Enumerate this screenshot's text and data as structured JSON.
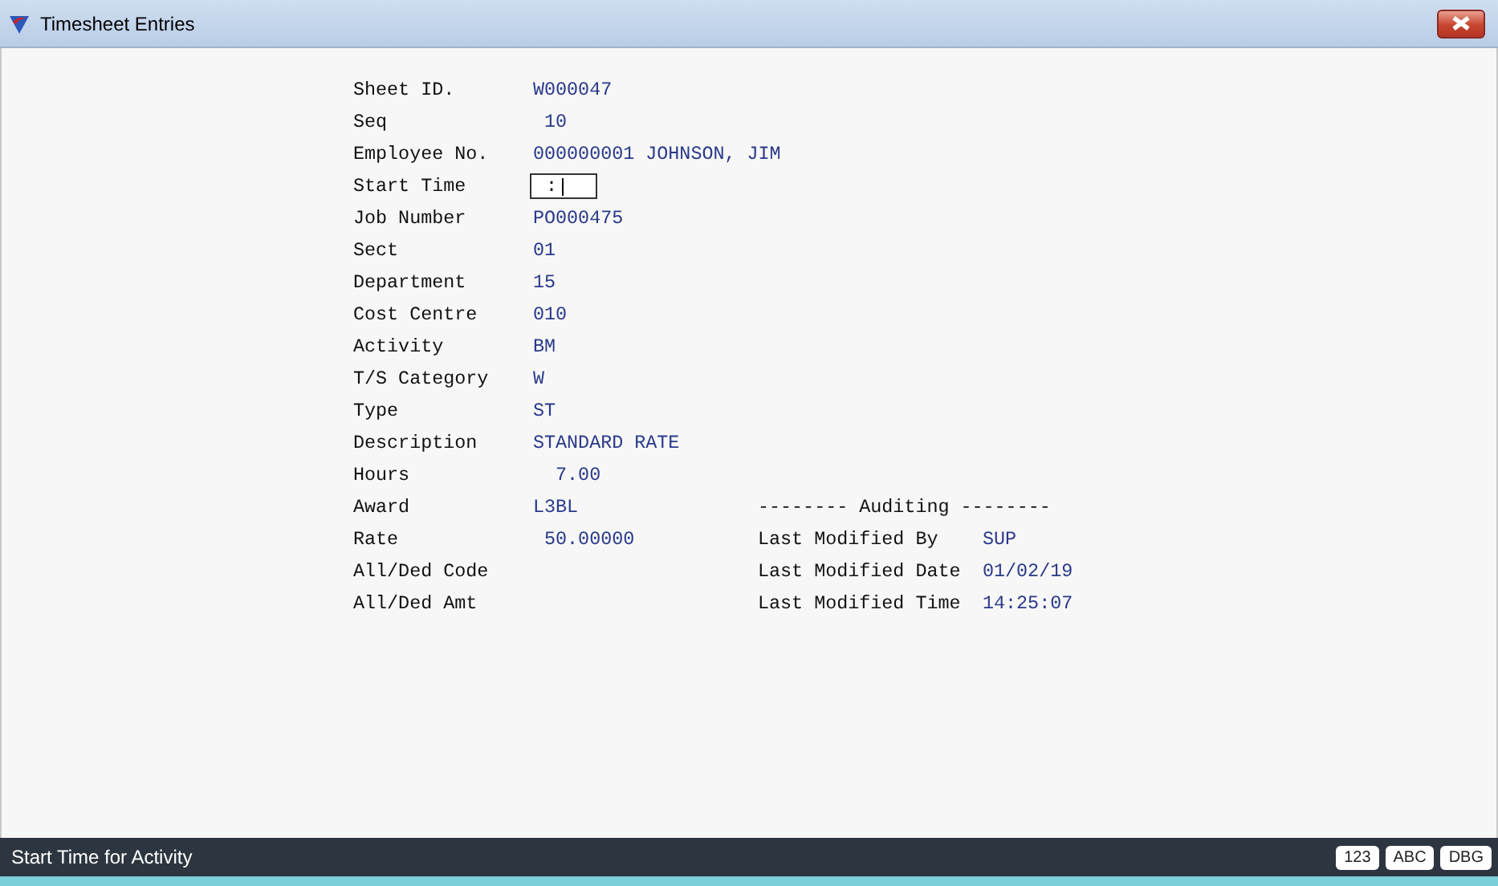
{
  "window": {
    "title": "Timesheet Entries"
  },
  "fields": [
    {
      "label": "Sheet ID.",
      "value": "W000047",
      "kind": "text"
    },
    {
      "label": "Seq",
      "value": " 10",
      "kind": "text"
    },
    {
      "label": "Employee No.",
      "value": "000000001 JOHNSON, JIM",
      "kind": "text"
    },
    {
      "label": "Start Time",
      "value": " :",
      "kind": "input"
    },
    {
      "label": "Job Number",
      "value": "PO000475",
      "kind": "text"
    },
    {
      "label": "Sect",
      "value": "01",
      "kind": "text"
    },
    {
      "label": "Department",
      "value": "15",
      "kind": "text"
    },
    {
      "label": "Cost Centre",
      "value": "010",
      "kind": "text"
    },
    {
      "label": "Activity",
      "value": "BM",
      "kind": "text"
    },
    {
      "label": "T/S Category",
      "value": "W",
      "kind": "text"
    },
    {
      "label": "Type",
      "value": "ST",
      "kind": "text"
    },
    {
      "label": "Description",
      "value": "STANDARD RATE",
      "kind": "text"
    },
    {
      "label": "Hours",
      "value": "  7.00",
      "kind": "text"
    },
    {
      "label": "Award",
      "value": "L3BL",
      "kind": "text"
    },
    {
      "label": "Rate",
      "value": " 50.00000",
      "kind": "text"
    },
    {
      "label": "All/Ded Code",
      "kind": "text"
    },
    {
      "label": "All/Ded Amt",
      "kind": "text"
    }
  ],
  "auditing": {
    "heading": "-------- Auditing --------",
    "fields": [
      {
        "label": "Last Modified By",
        "value": "SUP"
      },
      {
        "label": "Last Modified Date",
        "value": "01/02/19"
      },
      {
        "label": "Last Modified Time",
        "value": "14:25:07"
      }
    ]
  },
  "status_bar": {
    "text": "Start Time for Activity",
    "badges": [
      "123",
      "ABC",
      "DBG"
    ]
  }
}
